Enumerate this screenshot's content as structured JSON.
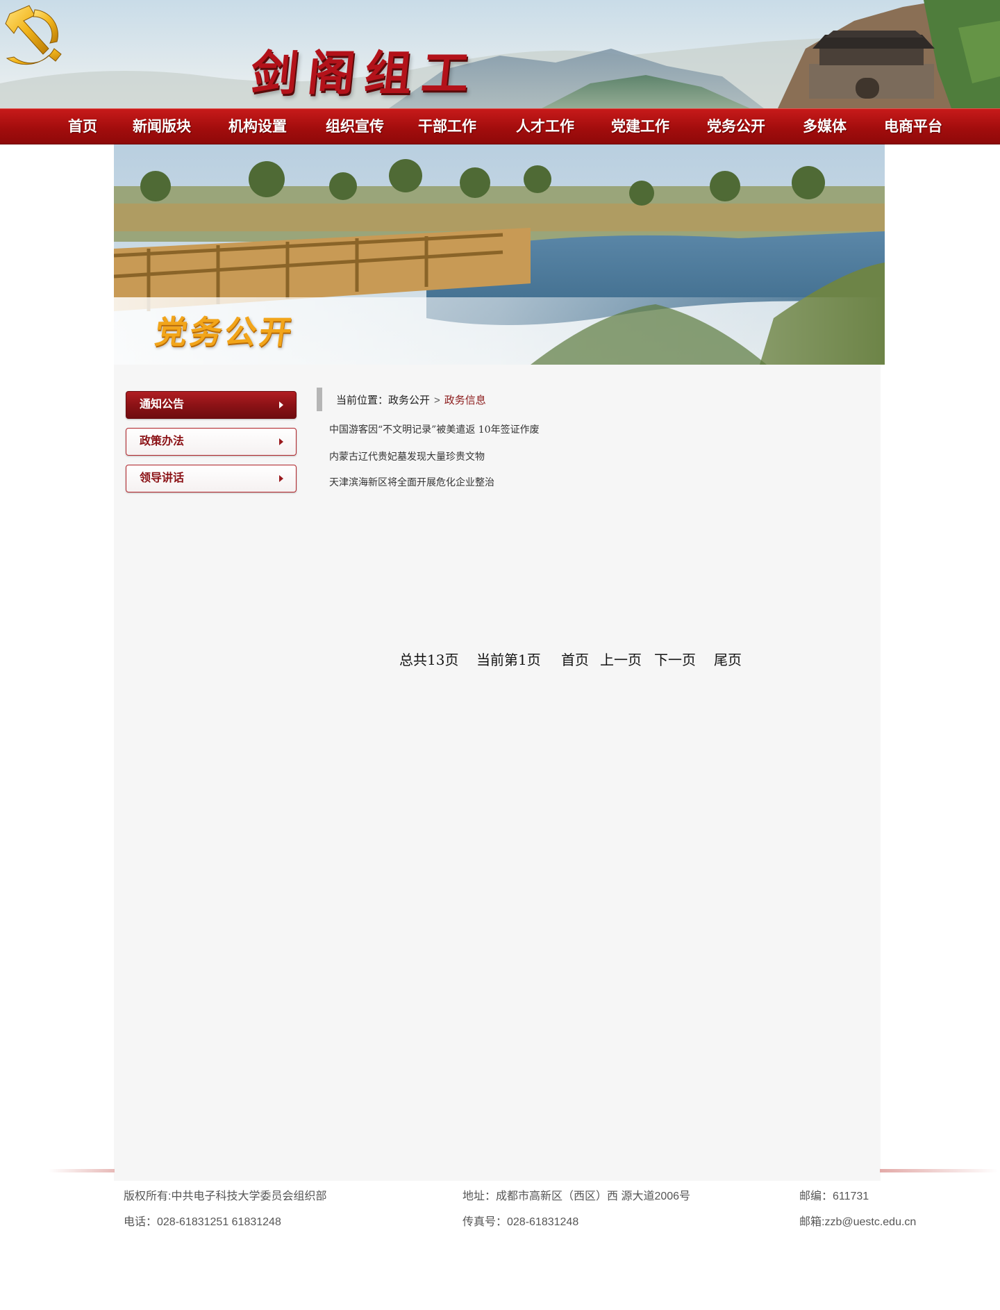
{
  "header": {
    "site_title": "剑阁组工"
  },
  "nav": {
    "items": [
      {
        "label": "首页"
      },
      {
        "label": "新闻版块"
      },
      {
        "label": "机构设置"
      },
      {
        "label": "组织宣传"
      },
      {
        "label": "干部工作"
      },
      {
        "label": "人才工作"
      },
      {
        "label": "党建工作"
      },
      {
        "label": "党务公开"
      },
      {
        "label": "多媒体"
      },
      {
        "label": "电商平台"
      }
    ]
  },
  "banner": {
    "title": "党务公开"
  },
  "sidebar": {
    "items": [
      {
        "label": "通知公告",
        "active": true
      },
      {
        "label": "政策办法",
        "active": false
      },
      {
        "label": "领导讲话",
        "active": false
      }
    ]
  },
  "breadcrumb": {
    "prefix": "当前位置：",
    "parent": "政务公开",
    "separator": ">",
    "current": "政务信息"
  },
  "news": [
    {
      "title": "中国游客因“不文明记录”被美遣返  10年签证作废"
    },
    {
      "title": "内蒙古辽代贵妃墓发现大量珍贵文物"
    },
    {
      "title": "天津滨海新区将全面开展危化企业整治"
    }
  ],
  "pagination": {
    "total": "总共13页",
    "current": "当前第1页",
    "first": "首页",
    "prev": "上一页",
    "next": "下一页",
    "last": "尾页"
  },
  "footer": {
    "copyright": "版权所有:中共电子科技大学委员会组织部",
    "phone": "电话：028-61831251 61831248",
    "address": "地址：成都市高新区（西区）西 源大道2006号",
    "fax": "传真号：028-61831248",
    "postcode": "邮编：611731",
    "email": "邮箱:zzb@uestc.edu.cn"
  },
  "colors": {
    "brand_red": "#a30d0d",
    "accent_dark_red": "#8b1216",
    "banner_gold": "#f2a51a",
    "content_bg": "#f6f6f6"
  }
}
